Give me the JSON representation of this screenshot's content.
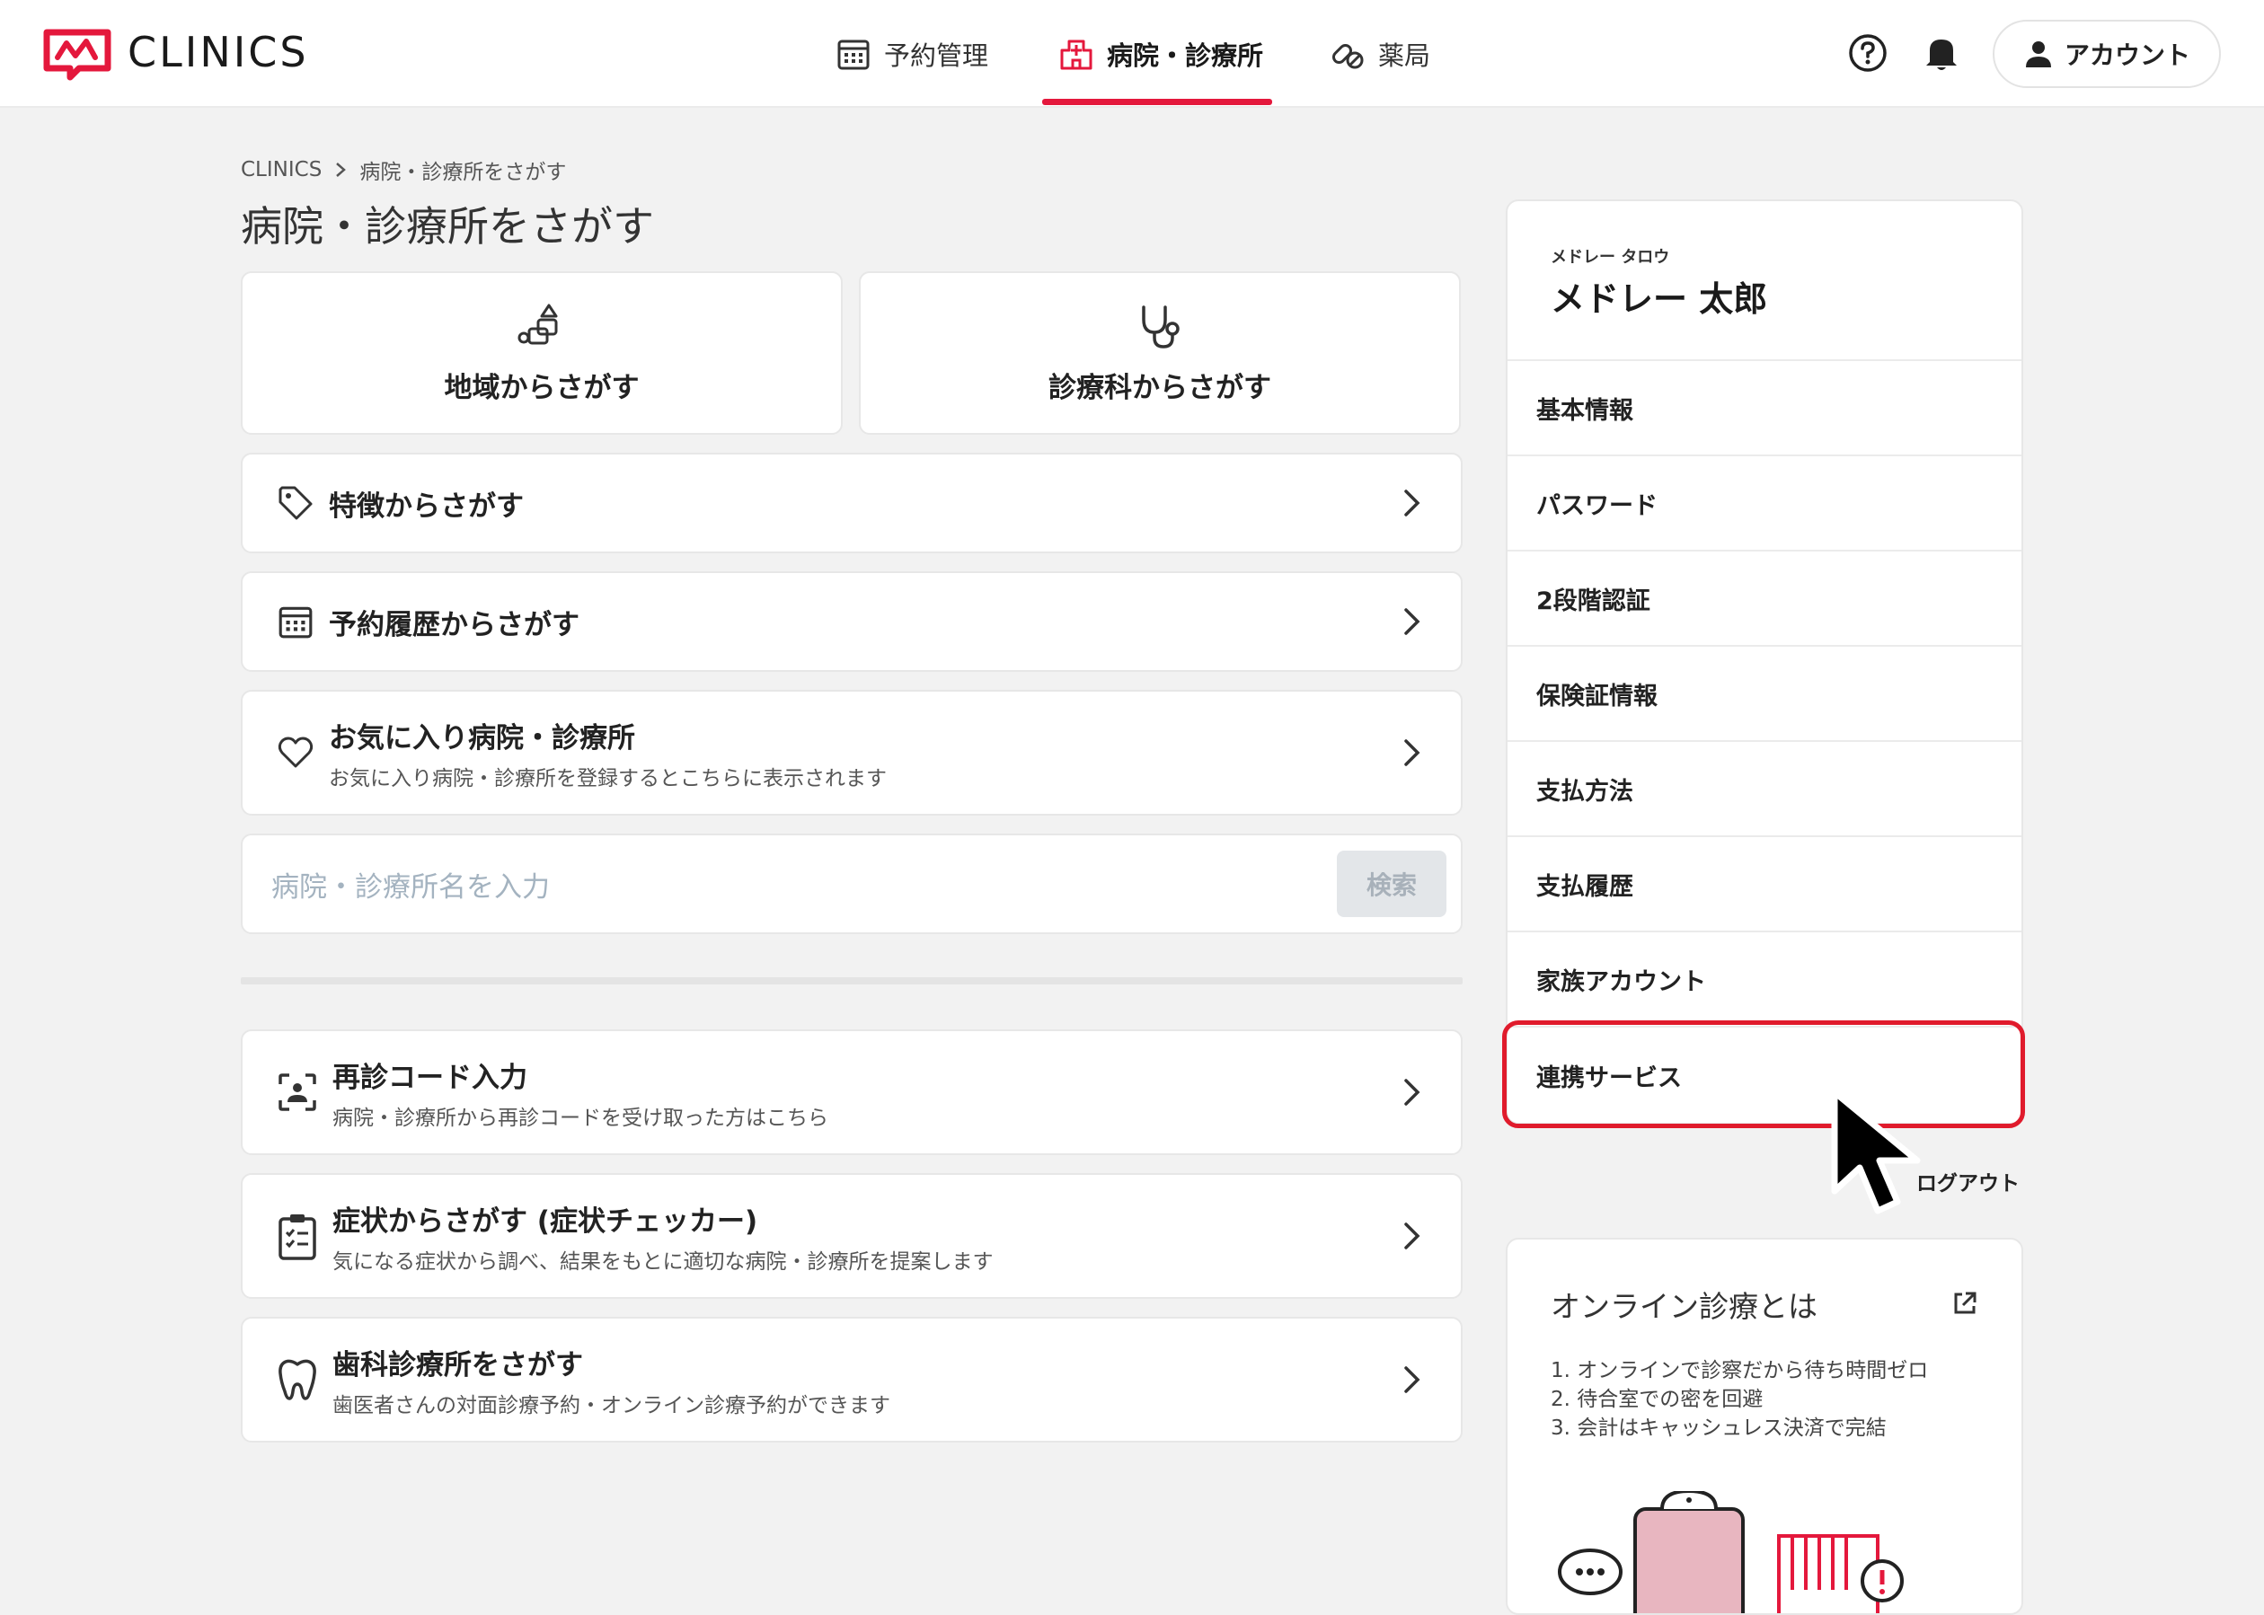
{
  "header": {
    "logo_text": "CLINICS",
    "nav": [
      {
        "label": "予約管理",
        "icon": "calendar-icon"
      },
      {
        "label": "病院・診療所",
        "icon": "hospital-icon",
        "active": true
      },
      {
        "label": "薬局",
        "icon": "pills-icon"
      }
    ],
    "account_label": "アカウント"
  },
  "breadcrumb": [
    "CLINICS",
    "病院・診療所をさがす"
  ],
  "page_title": "病院・診療所をさがす",
  "search_cards": [
    {
      "label": "地域からさがす",
      "icon": "map-location-icon"
    },
    {
      "label": "診療科からさがす",
      "icon": "stethoscope-icon"
    }
  ],
  "rows_top": [
    {
      "title": "特徴からさがす",
      "icon": "tag-icon"
    },
    {
      "title": "予約履歴からさがす",
      "icon": "calendar-icon"
    },
    {
      "title": "お気に入り病院・診療所",
      "subtitle": "お気に入り病院・診療所を登録するとこちらに表示されます",
      "icon": "heart-icon"
    }
  ],
  "search": {
    "placeholder": "病院・診療所名を入力",
    "button": "検索"
  },
  "rows_bottom": [
    {
      "title": "再診コード入力",
      "subtitle": "病院・診療所から再診コードを受け取った方はこちら",
      "icon": "qr-scan-icon"
    },
    {
      "title": "症状からさがす (症状チェッカー)",
      "subtitle": "気になる症状から調べ、結果をもとに適切な病院・診療所を提案します",
      "icon": "clipboard-check-icon"
    },
    {
      "title": "歯科診療所をさがす",
      "subtitle": "歯医者さんの対面診療予約・オンライン診療予約ができます",
      "icon": "tooth-icon"
    }
  ],
  "sidebar": {
    "user_kana": "メドレー タロウ",
    "user_name": "メドレー 太郎",
    "items": [
      "基本情報",
      "パスワード",
      "2段階認証",
      "保険証情報",
      "支払方法",
      "支払履歴",
      "家族アカウント",
      "連携サービス"
    ],
    "logout": "ログアウト"
  },
  "info": {
    "title": "オンライン診療とは",
    "points": [
      "1. オンラインで診察だから待ち時間ゼロ",
      "2. 待合室での密を回避",
      "3. 会計はキャッシュレス決済で完結"
    ]
  },
  "colors": {
    "accent": "#e4183c",
    "highlight": "#e01b2c"
  }
}
